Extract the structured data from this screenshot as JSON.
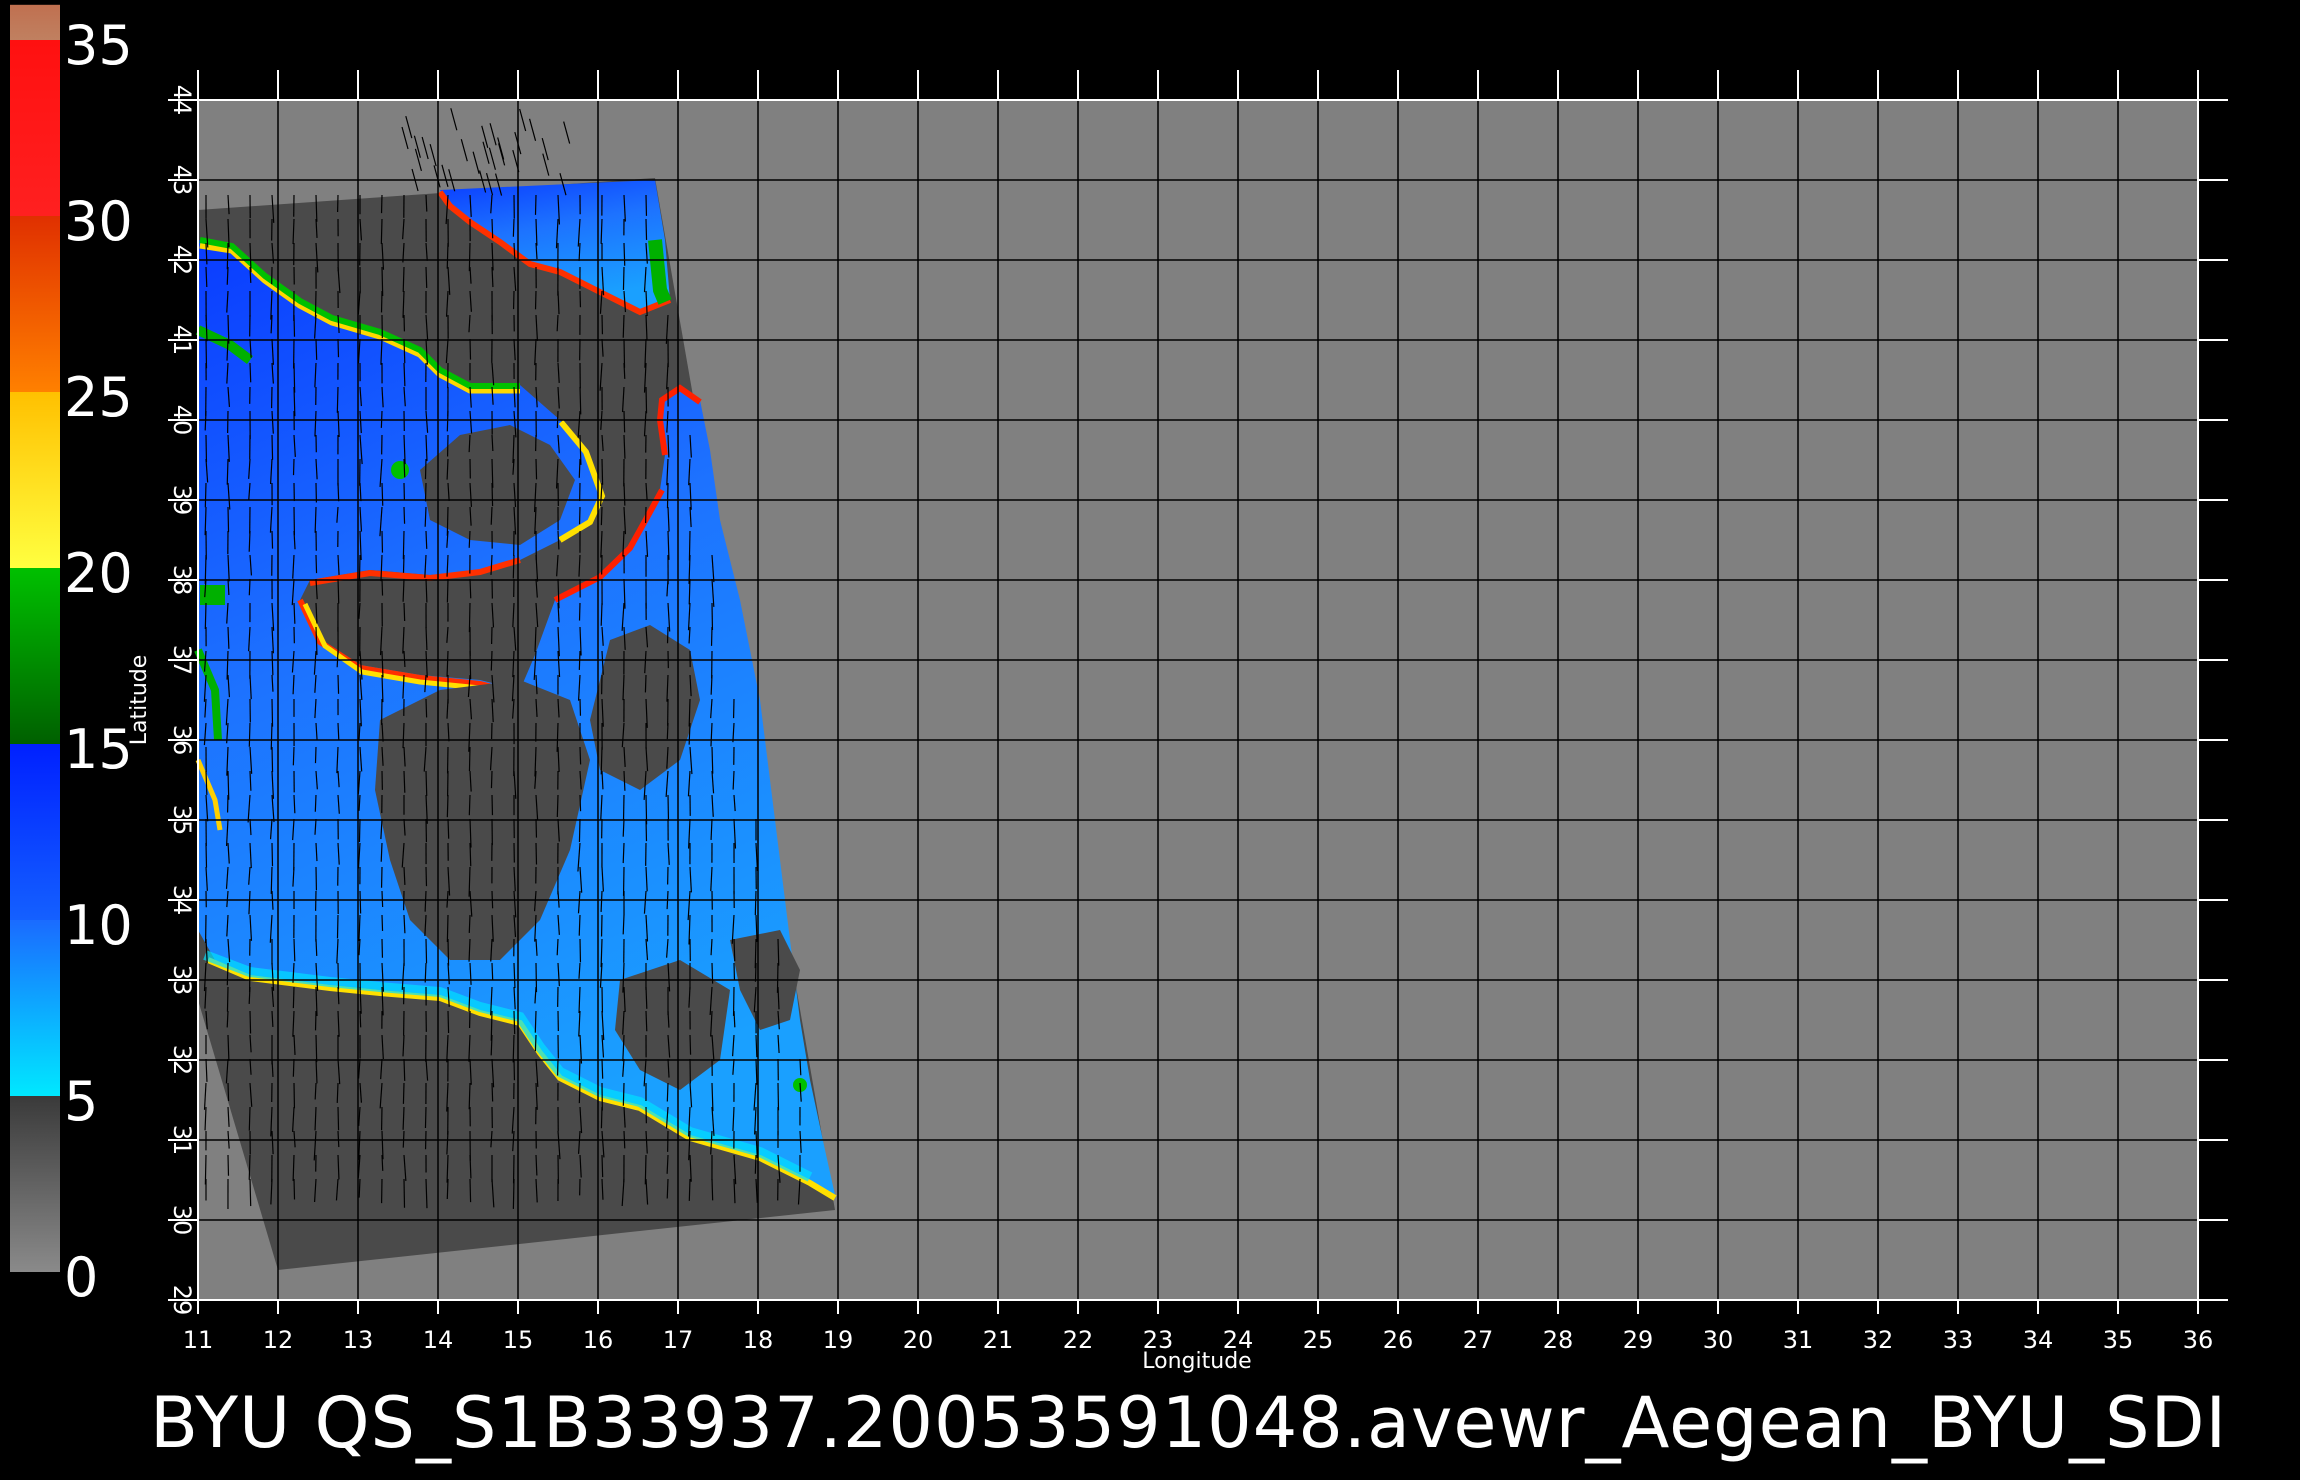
{
  "colorbar": {
    "labels": [
      "35",
      "30",
      "25",
      "20",
      "15",
      "10",
      "5",
      "0"
    ],
    "bands": [
      {
        "from": 0,
        "to": 5,
        "top": "#3a3a3a",
        "bottom": "#8a8a8a"
      },
      {
        "from": 5,
        "to": 10,
        "top": "#1a6bff",
        "bottom": "#00e8ff"
      },
      {
        "from": 10,
        "to": 15,
        "top": "#0020ff",
        "bottom": "#1460ff"
      },
      {
        "from": 15,
        "to": 20,
        "top": "#00c000",
        "bottom": "#006000"
      },
      {
        "from": 20,
        "to": 25,
        "top": "#ffc000",
        "bottom": "#ffff40"
      },
      {
        "from": 25,
        "to": 30,
        "top": "#e03000",
        "bottom": "#ff8000"
      },
      {
        "from": 30,
        "to": 35,
        "top": "#ff1010",
        "bottom": "#ff2020"
      },
      {
        "from": 35,
        "to": 36,
        "top": "#c07050",
        "bottom": "#c08060"
      }
    ]
  },
  "map": {
    "lon_range": [
      11,
      36
    ],
    "lat_range": [
      29,
      44
    ],
    "lon_ticks": [
      "11",
      "12",
      "13",
      "14",
      "15",
      "16",
      "17",
      "18",
      "19",
      "20",
      "21",
      "22",
      "23",
      "24",
      "25",
      "26",
      "27",
      "28",
      "29",
      "30",
      "31",
      "32",
      "33",
      "34",
      "35",
      "36"
    ],
    "lat_ticks": [
      "29",
      "30",
      "31",
      "32",
      "33",
      "34",
      "35",
      "36",
      "37",
      "38",
      "39",
      "40",
      "41",
      "42",
      "43",
      "44"
    ],
    "xlabel": "Longitude",
    "ylabel": "Latitude",
    "background_color": "#808080",
    "no_data_color": "#4a4a4a",
    "grid_color": "#000000"
  },
  "caption": "BYU  QS_S1B33937.20053591048.avewr_Aegean_BYU_SDI"
}
